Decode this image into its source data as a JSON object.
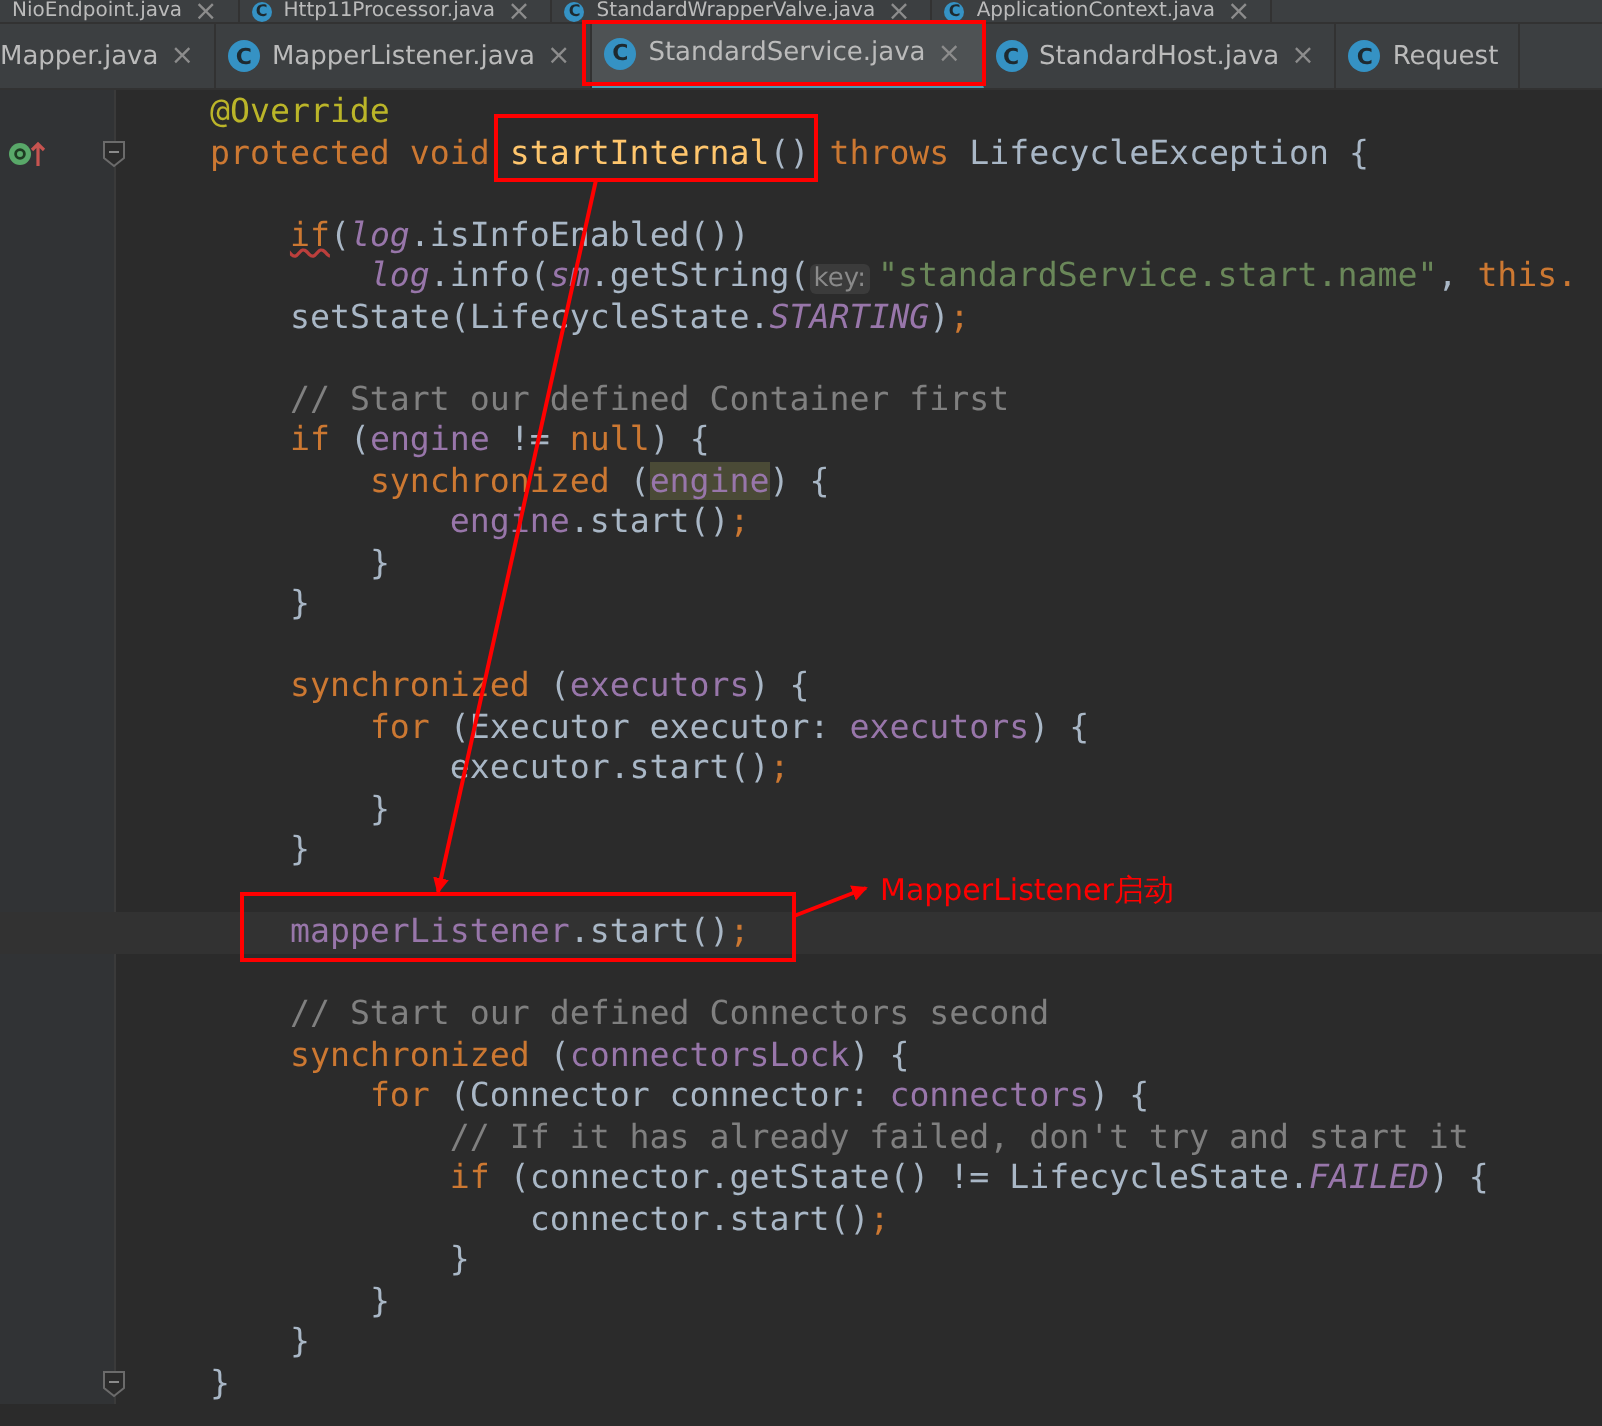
{
  "tab_rows": [
    {
      "tabs": [
        {
          "label": "NioEndpoint.java",
          "selected": false
        },
        {
          "label": "Http11Processor.java",
          "icon": "C",
          "selected": false
        },
        {
          "label": "StandardWrapperValve.java",
          "icon": "C",
          "selected": false
        },
        {
          "label": "ApplicationContext.java",
          "icon": "C",
          "selected": false
        }
      ]
    },
    {
      "tabs": [
        {
          "label": "Mapper.java",
          "selected": false
        },
        {
          "label": "MapperListener.java",
          "icon": "C",
          "selected": false
        },
        {
          "label": "StandardService.java",
          "icon": "C",
          "selected": true
        },
        {
          "label": "StandardHost.java",
          "icon": "C",
          "selected": false
        },
        {
          "label": "Request",
          "icon": "C",
          "selected": false,
          "closable": false
        }
      ]
    }
  ],
  "close_glyph": "×",
  "code_lines": [
    {
      "tokens": [
        {
          "text": "@Override",
          "kind": "ann"
        }
      ]
    },
    {
      "gutter": {
        "kind": "override"
      },
      "tokens": [
        {
          "text": "protected void ",
          "kind": "kw"
        },
        {
          "text": "startInternal",
          "kind": "decl"
        },
        {
          "text": "() ",
          "kind": "plain"
        },
        {
          "text": "throws ",
          "kind": "kw"
        },
        {
          "text": "LifecycleException {",
          "kind": "plain"
        }
      ]
    },
    {
      "kind": "blank"
    },
    {
      "tokens": [
        {
          "text": "    if",
          "kind": "warn"
        },
        {
          "text": "(",
          "kind": "plain"
        },
        {
          "text": "log",
          "kind": "sfield"
        },
        {
          "text": ".isInfoEnabled())",
          "kind": "plain"
        }
      ]
    },
    {
      "tokens": [
        {
          "text": "        log",
          "kind": "sfield"
        },
        {
          "text": ".info(",
          "kind": "plain"
        },
        {
          "text": "sm",
          "kind": "sfield"
        },
        {
          "text": ".getString(",
          "kind": "plain"
        },
        {
          "text": "key:",
          "kind": "hint"
        },
        {
          "text": "\"standardService.start.name\"",
          "kind": "str"
        },
        {
          "text": ", ",
          "kind": "plain"
        },
        {
          "text": "this.",
          "kind": "kw"
        }
      ]
    },
    {
      "tokens": [
        {
          "text": "    setState(LifecycleState.",
          "kind": "plain"
        },
        {
          "text": "STARTING",
          "kind": "sfield"
        },
        {
          "text": ")",
          "kind": "plain"
        },
        {
          "text": ";",
          "kind": "kw"
        }
      ]
    },
    {
      "kind": "blank"
    },
    {
      "tokens": [
        {
          "text": "    // Start our defined Container first",
          "kind": "comment"
        }
      ]
    },
    {
      "tokens": [
        {
          "text": "    if ",
          "kind": "kw"
        },
        {
          "text": "(",
          "kind": "plain"
        },
        {
          "text": "engine",
          "kind": "field"
        },
        {
          "text": " != ",
          "kind": "plain"
        },
        {
          "text": "null",
          "kind": "kw"
        },
        {
          "text": ") {",
          "kind": "plain"
        }
      ]
    },
    {
      "tokens": [
        {
          "text": "        synchronized ",
          "kind": "kw"
        },
        {
          "text": "(",
          "kind": "plain"
        },
        {
          "text": "engine",
          "kind": "fieldhl"
        },
        {
          "text": ") {",
          "kind": "plain"
        }
      ]
    },
    {
      "tokens": [
        {
          "text": "            engine",
          "kind": "field"
        },
        {
          "text": ".start()",
          "kind": "plain"
        },
        {
          "text": ";",
          "kind": "kw"
        }
      ]
    },
    {
      "tokens": [
        {
          "text": "        }",
          "kind": "plain"
        }
      ]
    },
    {
      "tokens": [
        {
          "text": "    }",
          "kind": "plain"
        }
      ]
    },
    {
      "kind": "blank"
    },
    {
      "tokens": [
        {
          "text": "    synchronized ",
          "kind": "kw"
        },
        {
          "text": "(",
          "kind": "plain"
        },
        {
          "text": "executors",
          "kind": "field"
        },
        {
          "text": ") {",
          "kind": "plain"
        }
      ]
    },
    {
      "tokens": [
        {
          "text": "        for ",
          "kind": "kw"
        },
        {
          "text": "(Executor executor: ",
          "kind": "plain"
        },
        {
          "text": "executors",
          "kind": "field"
        },
        {
          "text": ") {",
          "kind": "plain"
        }
      ]
    },
    {
      "tokens": [
        {
          "text": "            executor.start()",
          "kind": "plain"
        },
        {
          "text": ";",
          "kind": "kw"
        }
      ]
    },
    {
      "tokens": [
        {
          "text": "        }",
          "kind": "plain"
        }
      ]
    },
    {
      "tokens": [
        {
          "text": "    }",
          "kind": "plain"
        }
      ]
    },
    {
      "kind": "blank"
    },
    {
      "current": true,
      "tokens": [
        {
          "text": "    mapperListener",
          "kind": "field"
        },
        {
          "text": ".start()",
          "kind": "plain"
        },
        {
          "text": ";",
          "kind": "kw"
        }
      ]
    },
    {
      "kind": "blank"
    },
    {
      "tokens": [
        {
          "text": "    // Start our defined Connectors second",
          "kind": "comment"
        }
      ]
    },
    {
      "tokens": [
        {
          "text": "    synchronized ",
          "kind": "kw"
        },
        {
          "text": "(",
          "kind": "plain"
        },
        {
          "text": "connectorsLock",
          "kind": "field"
        },
        {
          "text": ") {",
          "kind": "plain"
        }
      ]
    },
    {
      "tokens": [
        {
          "text": "        for ",
          "kind": "kw"
        },
        {
          "text": "(Connector connector: ",
          "kind": "plain"
        },
        {
          "text": "connectors",
          "kind": "field"
        },
        {
          "text": ") {",
          "kind": "plain"
        }
      ]
    },
    {
      "tokens": [
        {
          "text": "            // If it has already failed, don't try and start it",
          "kind": "comment"
        }
      ]
    },
    {
      "tokens": [
        {
          "text": "            if ",
          "kind": "kw"
        },
        {
          "text": "(connector.getState() != LifecycleState.",
          "kind": "plain"
        },
        {
          "text": "FAILED",
          "kind": "sfield"
        },
        {
          "text": ") {",
          "kind": "plain"
        }
      ]
    },
    {
      "tokens": [
        {
          "text": "                connector.start()",
          "kind": "plain"
        },
        {
          "text": ";",
          "kind": "kw"
        }
      ]
    },
    {
      "tokens": [
        {
          "text": "            }",
          "kind": "plain"
        }
      ]
    },
    {
      "tokens": [
        {
          "text": "        }",
          "kind": "plain"
        }
      ]
    },
    {
      "tokens": [
        {
          "text": "    }",
          "kind": "plain"
        }
      ]
    },
    {
      "gutter": {
        "kind": "fold"
      },
      "tokens": [
        {
          "text": "}",
          "kind": "plain"
        }
      ]
    }
  ],
  "annotation": {
    "text": "MapperListener启动"
  }
}
